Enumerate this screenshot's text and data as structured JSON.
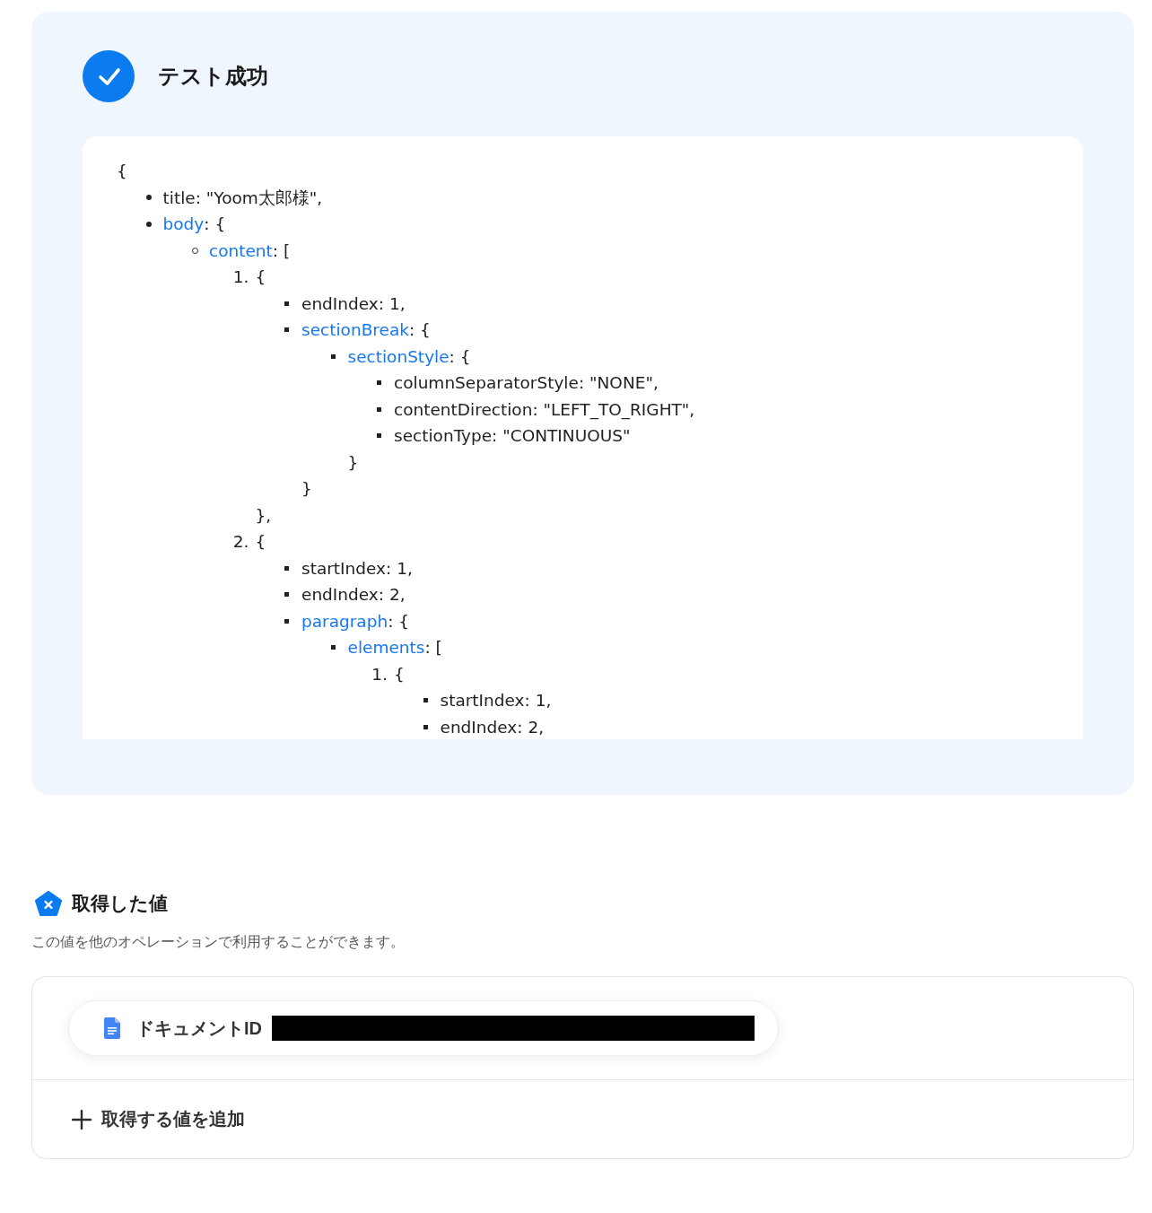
{
  "result_panel": {
    "passed": true,
    "title": "テスト成功",
    "output": {
      "open": "{",
      "items": [
        {
          "kind": "field",
          "key": "title",
          "text": ": \"Yoom太郎様\","
        },
        {
          "kind": "link",
          "key": "body",
          "text": ": {",
          "children": [
            {
              "kind": "link",
              "key": "content",
              "text": ": [",
              "children": [
                {
                  "kind": "index",
                  "number": "1.",
                  "text": "{",
                  "close": "},",
                  "children": [
                    {
                      "kind": "field",
                      "key": "endIndex",
                      "text": ": 1,"
                    },
                    {
                      "kind": "link",
                      "key": "sectionBreak",
                      "text": ": {",
                      "close": "}",
                      "children": [
                        {
                          "kind": "link",
                          "key": "sectionStyle",
                          "text": ": {",
                          "close": "}",
                          "children": [
                            {
                              "kind": "field",
                              "key": "columnSeparatorStyle",
                              "text": ": \"NONE\","
                            },
                            {
                              "kind": "field",
                              "key": "contentDirection",
                              "text": ": \"LEFT_TO_RIGHT\","
                            },
                            {
                              "kind": "field",
                              "key": "sectionType",
                              "text": ": \"CONTINUOUS\""
                            }
                          ]
                        }
                      ]
                    }
                  ]
                },
                {
                  "kind": "index",
                  "number": "2.",
                  "text": "{",
                  "children": [
                    {
                      "kind": "field",
                      "key": "startIndex",
                      "text": ": 1,"
                    },
                    {
                      "kind": "field",
                      "key": "endIndex",
                      "text": ": 2,"
                    },
                    {
                      "kind": "link",
                      "key": "paragraph",
                      "text": ": {",
                      "children": [
                        {
                          "kind": "link",
                          "key": "elements",
                          "text": ": [",
                          "children": [
                            {
                              "kind": "index",
                              "number": "1.",
                              "text": "{",
                              "children": [
                                {
                                  "kind": "field",
                                  "key": "startIndex",
                                  "text": ": 1,"
                                },
                                {
                                  "kind": "field",
                                  "key": "endIndex",
                                  "text": ": 2,"
                                }
                              ]
                            }
                          ]
                        }
                      ]
                    }
                  ]
                }
              ]
            }
          ]
        }
      ]
    }
  },
  "extracted_values": {
    "title": "取得した値",
    "description": "この値を他のオペレーションで利用することができます。",
    "values": [
      {
        "label": "ドキュメントID",
        "redacted": true
      }
    ],
    "add_button": "取得する値を追加"
  }
}
